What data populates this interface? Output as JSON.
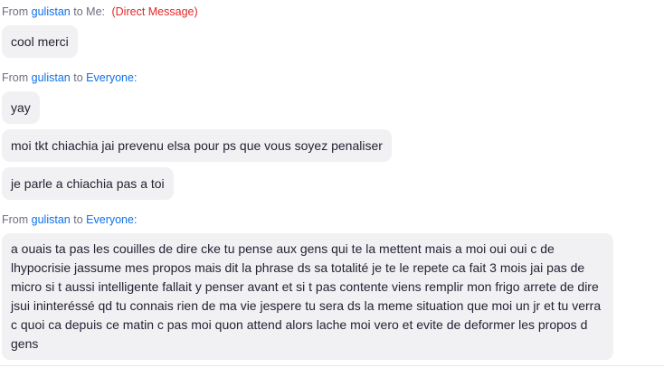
{
  "groups": [
    {
      "from_prefix": "From",
      "sender": "gulistan",
      "to_word": "to",
      "recipient": "Me:",
      "tag": "(Direct Message)",
      "messages": [
        "cool merci"
      ]
    },
    {
      "from_prefix": "From",
      "sender": "gulistan",
      "to_word": "to",
      "recipient": "Everyone:",
      "messages": [
        "yay",
        "moi tkt chiachia jai prevenu elsa pour ps que vous soyez penaliser",
        "je parle a chiachia pas a toi"
      ]
    },
    {
      "from_prefix": "From",
      "sender": "gulistan",
      "to_word": "to",
      "recipient": "Everyone:",
      "messages": [
        "a ouais ta pas les couilles de dire cke tu pense aux gens qui te la mettent mais a moi oui oui c de lhypocrisie jassume mes propos mais dit la phrase ds sa totalité je te le repete ca fait 3 mois jai pas de micro si t aussi intelligente fallait y penser avant et si t pas contente viens remplir mon frigo arrete de dire jsui ininteréssé qd tu connais rien de ma vie jespere tu sera ds la meme situation que moi un jr et tu verra c quoi ca depuis ce matin c pas moi quon attend alors lache moi  vero et evite de deformer les propos d gens"
      ]
    }
  ]
}
